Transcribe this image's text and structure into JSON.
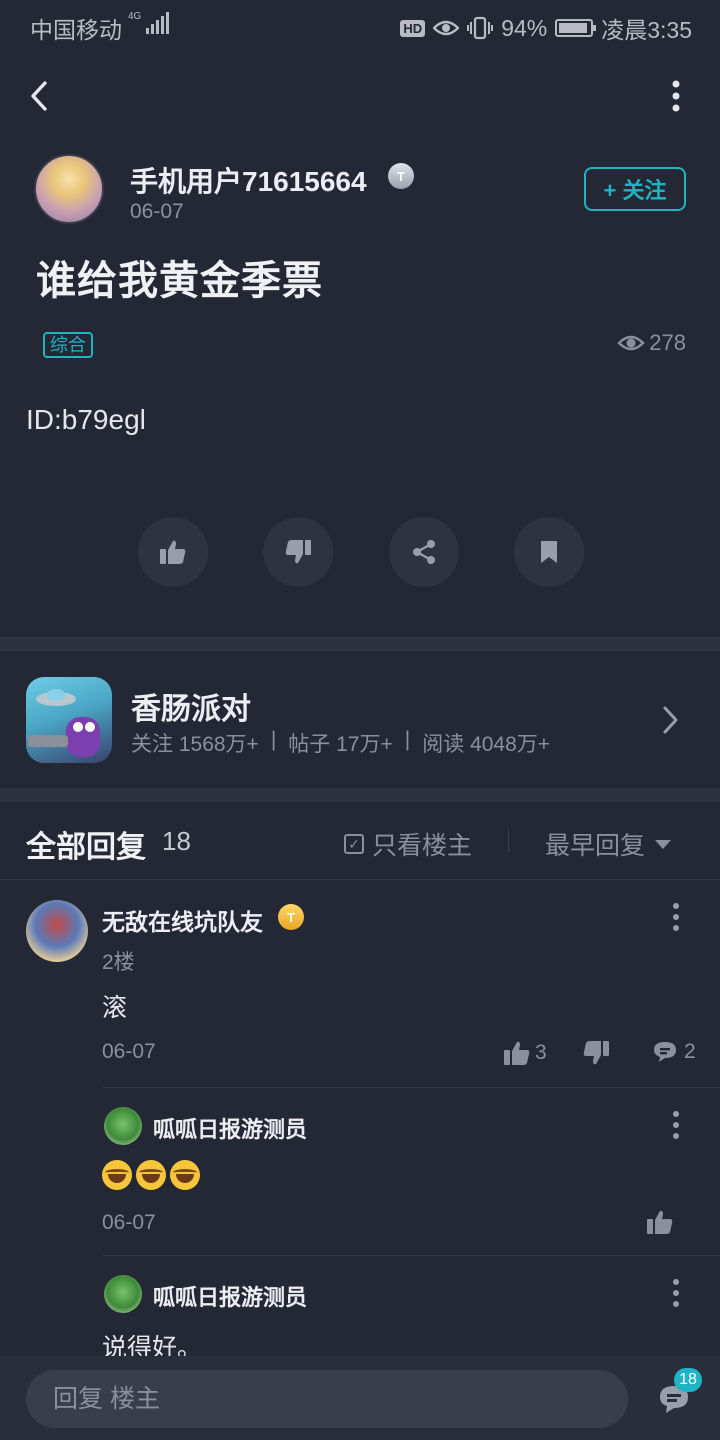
{
  "status_bar": {
    "carrier": "中国移动",
    "network": "4G",
    "hd": "HD",
    "battery": "94%",
    "battery_level": 0.94,
    "time": "凌晨3:35"
  },
  "nav": {
    "back_icon": "chevron-left-icon",
    "more_icon": "vertical-dots-icon"
  },
  "post": {
    "author": "手机用户71615664",
    "author_badge": "T",
    "date": "06-07",
    "follow_label": "+ 关注",
    "title": "谁给我黄金季票",
    "category": "综合",
    "views": "278",
    "body": "ID:b79egl"
  },
  "actions": [
    "thumbs-up-icon",
    "thumbs-down-icon",
    "share-icon",
    "bookmark-icon"
  ],
  "game": {
    "name": "香肠派对",
    "followers": "关注 1568万+",
    "posts": "帖子 17万+",
    "reads": "阅读 4048万+",
    "sep": "|"
  },
  "replies": {
    "title": "全部回复",
    "count": "18",
    "only_op": "只看楼主",
    "sort": "最早回复",
    "colors": {
      "accent": "#1fb4c4",
      "gold": "#e8a424"
    }
  },
  "comment": {
    "author": "无敌在线坑队友",
    "badge": "T",
    "floor": "2楼",
    "text": "滚",
    "date": "06-07",
    "likes": "3",
    "replies": "2",
    "sub_replies": [
      {
        "author": "呱呱日报游测员",
        "text": "",
        "emoji_count": 3,
        "date": "06-07"
      },
      {
        "author": "呱呱日报游测员",
        "text": "说得好。"
      }
    ]
  },
  "bottom": {
    "reply_placeholder": "回复  楼主",
    "comments_badge": "18"
  }
}
